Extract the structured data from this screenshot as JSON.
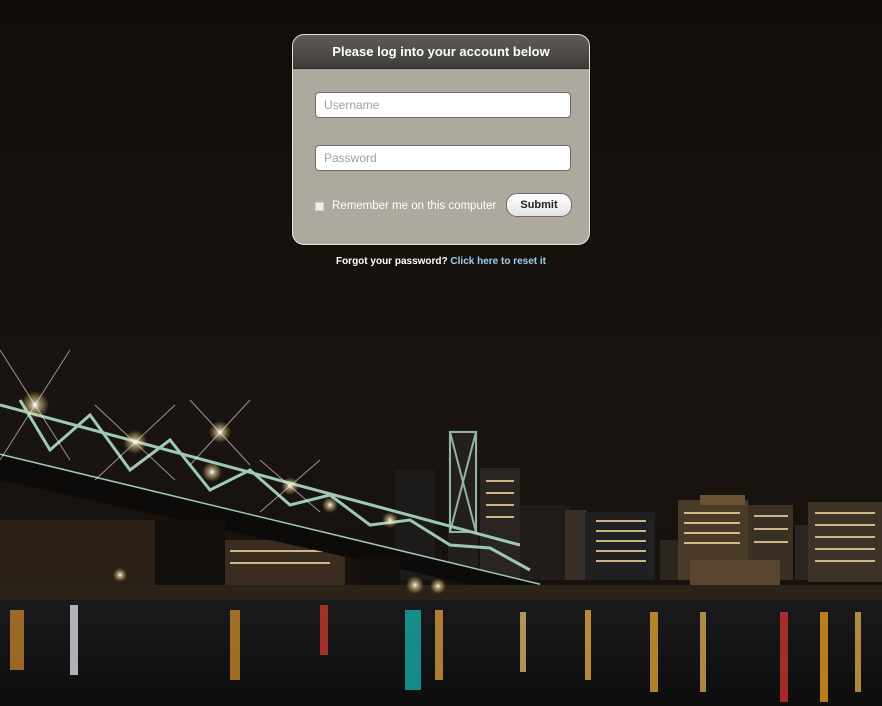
{
  "login": {
    "header": "Please log into your account below",
    "username_placeholder": "Username",
    "password_placeholder": "Password",
    "remember_label": "Remember me on this computer",
    "submit_label": "Submit"
  },
  "forgot": {
    "question": "Forgot your password?",
    "link_text": "Click here to reset it"
  },
  "colors": {
    "card_background": "#aea99f",
    "header_background": "#4a4744",
    "link": "#9ccfee",
    "page_background": "#150f0c"
  },
  "icons": [
    "checkbox-icon"
  ]
}
